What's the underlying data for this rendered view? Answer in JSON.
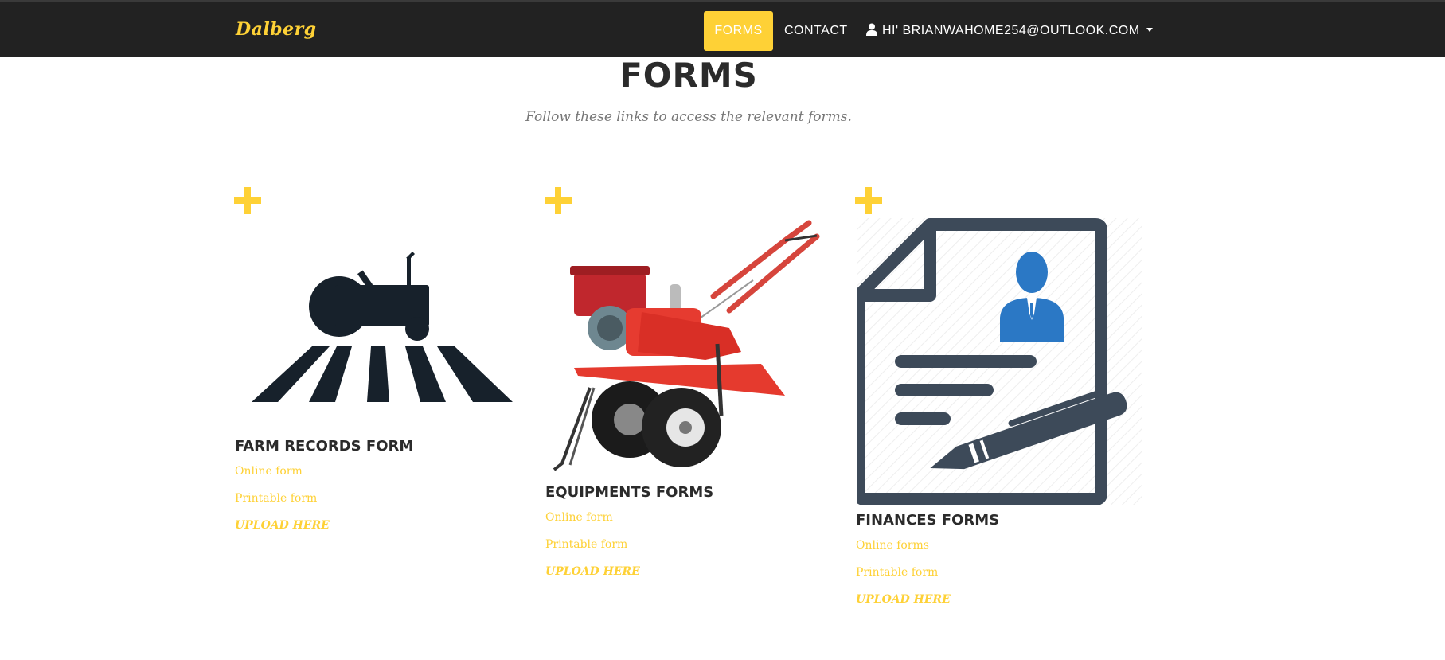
{
  "navbar": {
    "brand": "Dalberg",
    "items": [
      {
        "label": "FORMS",
        "active": true
      },
      {
        "label": "CONTACT"
      }
    ],
    "user": {
      "label": "HI' BRIANWAHOME254@OUTLOOK.COM",
      "icon": "user-icon"
    }
  },
  "header": {
    "title": "FORMS",
    "subtitle": "Follow these links to access the relevant forms."
  },
  "columns": [
    {
      "title": "FARM RECORDS FORM",
      "image": "tractor-field-icon",
      "links": [
        "Online form",
        "Printable form",
        "UPLOAD HERE"
      ]
    },
    {
      "title": "EQUIPMENTS FORMS",
      "image": "rotary-tiller-image",
      "links": [
        "Online form",
        "Printable form",
        "UPLOAD HERE"
      ]
    },
    {
      "title": "FINANCES FORMS",
      "image": "document-signature-icon",
      "links": [
        "Online forms",
        "Printable form",
        "UPLOAD HERE"
      ]
    }
  ],
  "colors": {
    "accent": "#fed136",
    "navbar": "#222222",
    "heading": "#2b2b2b",
    "subtitle": "#777777"
  }
}
